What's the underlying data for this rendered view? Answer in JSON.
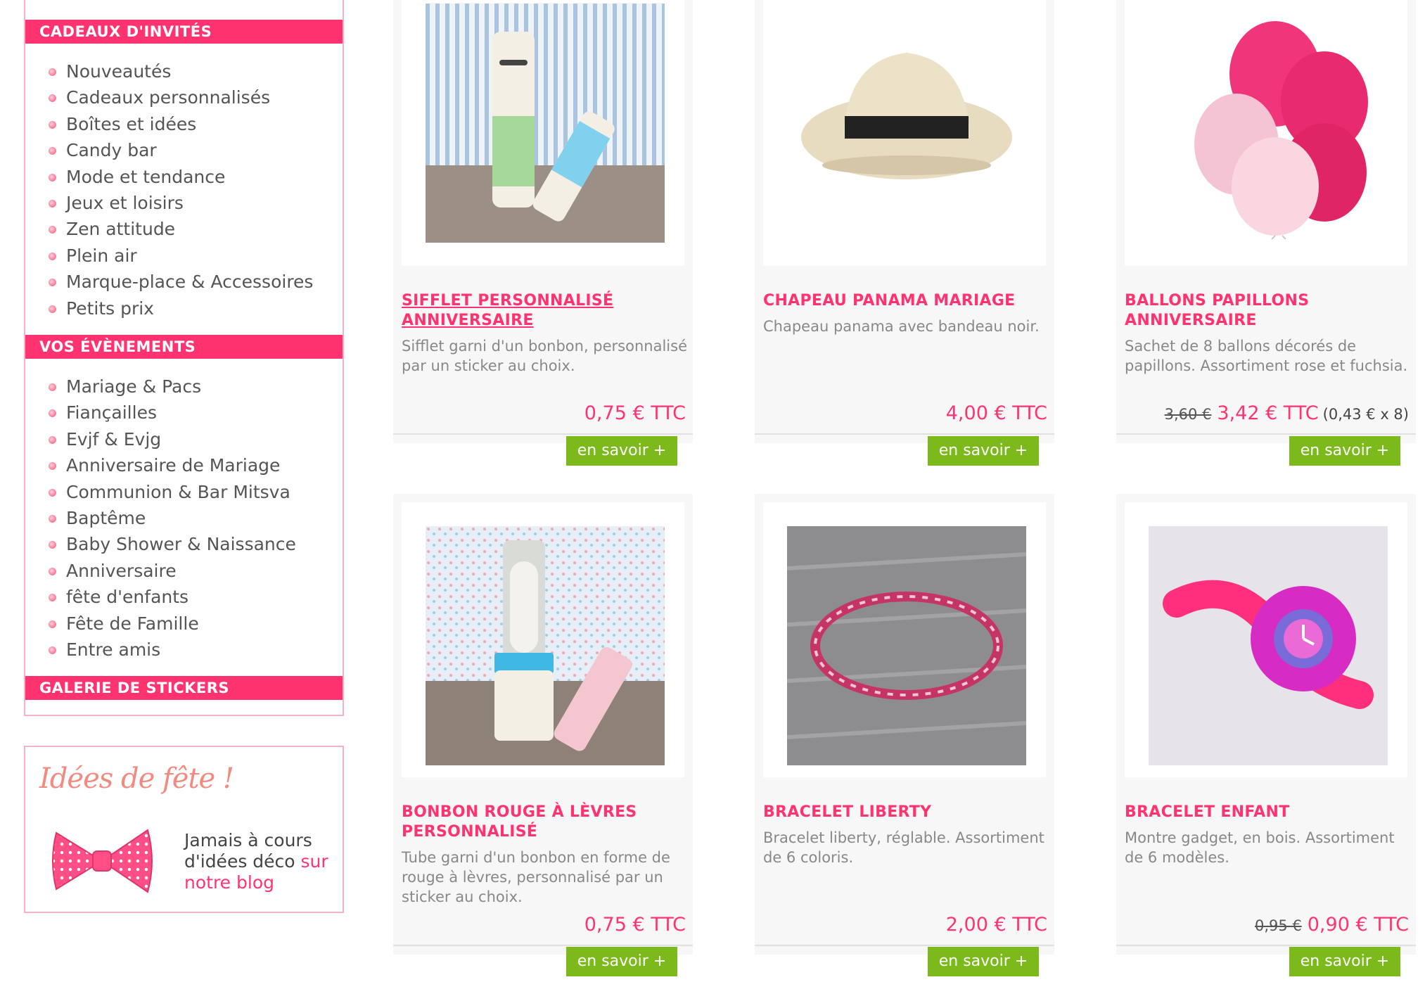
{
  "sidebar": {
    "sections": [
      {
        "title": "CADEAUX D'INVITÉS",
        "items": [
          "Nouveautés",
          "Cadeaux personnalisés",
          "Boîtes et idées",
          "Candy bar",
          "Mode et tendance",
          "Jeux et loisirs",
          "Zen attitude",
          "Plein air",
          "Marque-place & Accessoires",
          "Petits prix"
        ]
      },
      {
        "title": "VOS ÉVÈNEMENTS",
        "items": [
          "Mariage & Pacs",
          "Fiançailles",
          "Evjf & Evjg",
          "Anniversaire de Mariage",
          "Communion & Bar Mitsva",
          "Baptême",
          "Baby Shower & Naissance",
          "Anniversaire",
          "fête d'enfants",
          "Fête de Famille",
          "Entre amis"
        ]
      },
      {
        "title": "GALERIE DE STICKERS",
        "items": []
      }
    ],
    "blog": {
      "title": "Idées de fête !",
      "text": "Jamais à cours d'idées déco ",
      "link_text": "sur notre blog"
    }
  },
  "products": [
    {
      "title": "SIFFLET PERSONNALISÉ ANNIVERSAIRE",
      "desc": "Sifflet garni d'un bonbon, personnalisé par un sticker au choix.",
      "old_price": "",
      "price": "0,75 € TTC",
      "unit_price": "",
      "button": "en savoir +",
      "image": "whistle-photo"
    },
    {
      "title": "CHAPEAU PANAMA MARIAGE",
      "desc": "Chapeau panama avec bandeau noir.",
      "old_price": "",
      "price": "4,00 € TTC",
      "unit_price": "",
      "button": "en savoir +",
      "image": "panama-hat-photo"
    },
    {
      "title": "BALLONS PAPILLONS ANNIVERSAIRE",
      "desc": "Sachet de 8 ballons décorés de papillons. Assortiment rose et fuchsia.",
      "old_price": "3,60 €",
      "price": "3,42 € TTC",
      "unit_price": "(0,43 € x 8)",
      "button": "en savoir +",
      "image": "balloons-photo"
    },
    {
      "title": "BONBON ROUGE À LÈVRES PERSONNALISÉ",
      "desc": "Tube garni d'un bonbon en forme de rouge à lèvres, personnalisé par un sticker au choix.",
      "old_price": "",
      "price": "0,75 € TTC",
      "unit_price": "",
      "button": "en savoir +",
      "image": "lipstick-candy-photo"
    },
    {
      "title": "BRACELET LIBERTY",
      "desc": "Bracelet liberty, réglable. Assortiment de 6 coloris.",
      "old_price": "",
      "price": "2,00 € TTC",
      "unit_price": "",
      "button": "en savoir +",
      "image": "liberty-bracelet-photo"
    },
    {
      "title": "BRACELET ENFANT",
      "desc": "Montre gadget, en bois. Assortiment de 6 modèles.",
      "old_price": "0,95 €",
      "price": "0,90 € TTC",
      "unit_price": "",
      "button": "en savoir +",
      "image": "kid-watch-photo"
    }
  ],
  "colors": {
    "accent": "#ff3370",
    "button": "#7cba1b",
    "border": "#f7b3c6"
  }
}
